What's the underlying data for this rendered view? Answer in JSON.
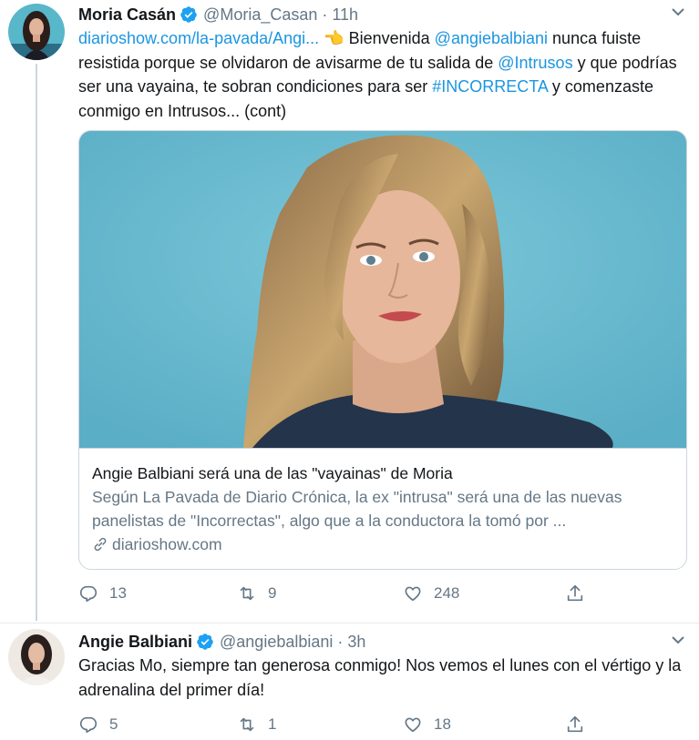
{
  "tweets": [
    {
      "author": "Moria Casán",
      "handle": "@Moria_Casan",
      "separator": "·",
      "time": "11h",
      "text": {
        "link": "diarioshow.com/la-pavada/Angi...",
        "emoji": "👈",
        "part1": " Bienvenida ",
        "mention1": "@angiebalbiani",
        "part2": " nunca fuiste resistida porque se olvidaron de avisarme de tu salida de ",
        "mention2": "@Intrusos",
        "part3": " y que podrías ser una vayaina, te sobran condiciones para ser ",
        "hashtag": "#INCORRECTA",
        "part4": " y comenzaste conmigo en Intrusos... (cont)"
      },
      "card": {
        "title": "Angie Balbiani será una de las \"vayainas\" de Moria",
        "description": "Según La Pavada de Diario Crónica, la ex \"intrusa\" será una de las nuevas panelistas de \"Incorrectas\", algo que a la conductora la tomó por ...",
        "domain": "diarioshow.com"
      },
      "actions": {
        "replies": "13",
        "retweets": "9",
        "likes": "248"
      }
    },
    {
      "author": "Angie Balbiani",
      "handle": "@angiebalbiani",
      "separator": "·",
      "time": "3h",
      "text": "Gracias Mo, siempre tan generosa conmigo! Nos vemos el lunes con el vértigo y la adrenalina del primer día!",
      "actions": {
        "replies": "5",
        "retweets": "1",
        "likes": "18"
      }
    }
  ],
  "colors": {
    "link": "#1b95e0",
    "verified": "#1da1f2",
    "secondary_text": "#657786",
    "card_background": "#6fbcd3"
  },
  "icons": [
    "verified-badge-icon",
    "chevron-down-icon",
    "reply-icon",
    "retweet-icon",
    "like-icon",
    "share-icon",
    "link-icon"
  ]
}
